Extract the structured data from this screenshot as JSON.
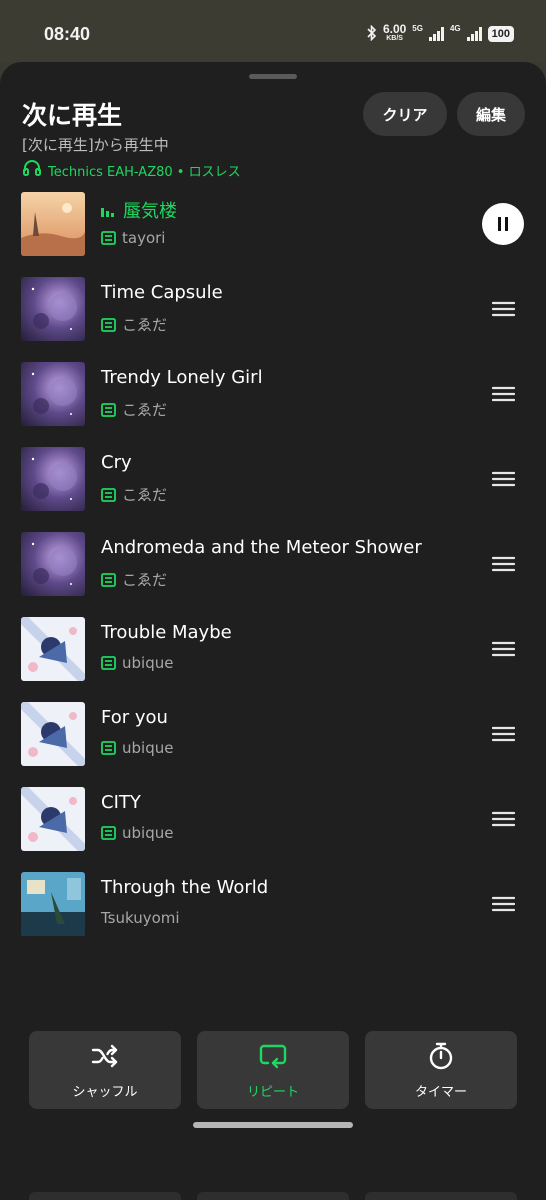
{
  "status": {
    "time": "08:40",
    "speed_value": "6.00",
    "speed_unit": "KB/S",
    "network1": "5G",
    "network2": "4G",
    "battery": "100"
  },
  "header": {
    "title": "次に再生",
    "subtitle": "[次に再生]から再生中",
    "device": "Technics EAH-AZ80 • ロスレス",
    "clear_label": "クリア",
    "edit_label": "編集"
  },
  "colors": {
    "accent": "#1ed760",
    "background": "#1f1f1f",
    "button": "#383838"
  },
  "tracks": [
    {
      "title": "蜃気楼",
      "artist": "tayori",
      "downloaded": true,
      "playing": true,
      "art": "desert"
    },
    {
      "title": "Time Capsule",
      "artist": "こゑだ",
      "downloaded": true,
      "art": "nebula"
    },
    {
      "title": "Trendy Lonely Girl",
      "artist": "こゑだ",
      "downloaded": true,
      "art": "nebula"
    },
    {
      "title": "Cry",
      "artist": "こゑだ",
      "downloaded": true,
      "art": "nebula"
    },
    {
      "title": "Andromeda and the Meteor Shower",
      "artist": "こゑだ",
      "downloaded": true,
      "art": "nebula"
    },
    {
      "title": "Trouble Maybe",
      "artist": "ubique",
      "downloaded": true,
      "art": "anime"
    },
    {
      "title": "For you",
      "artist": "ubique",
      "downloaded": true,
      "art": "anime"
    },
    {
      "title": "CITY",
      "artist": "ubique",
      "downloaded": true,
      "art": "anime"
    },
    {
      "title": "Through the World",
      "artist": "Tsukuyomi",
      "downloaded": false,
      "art": "sky"
    }
  ],
  "controls": {
    "shuffle_label": "シャッフル",
    "repeat_label": "リピート",
    "timer_label": "タイマー"
  },
  "icons": [
    "bluetooth-icon",
    "headphones-icon",
    "download-icon",
    "pause-icon",
    "drag-handle-icon",
    "shuffle-icon",
    "repeat-icon",
    "timer-icon"
  ]
}
